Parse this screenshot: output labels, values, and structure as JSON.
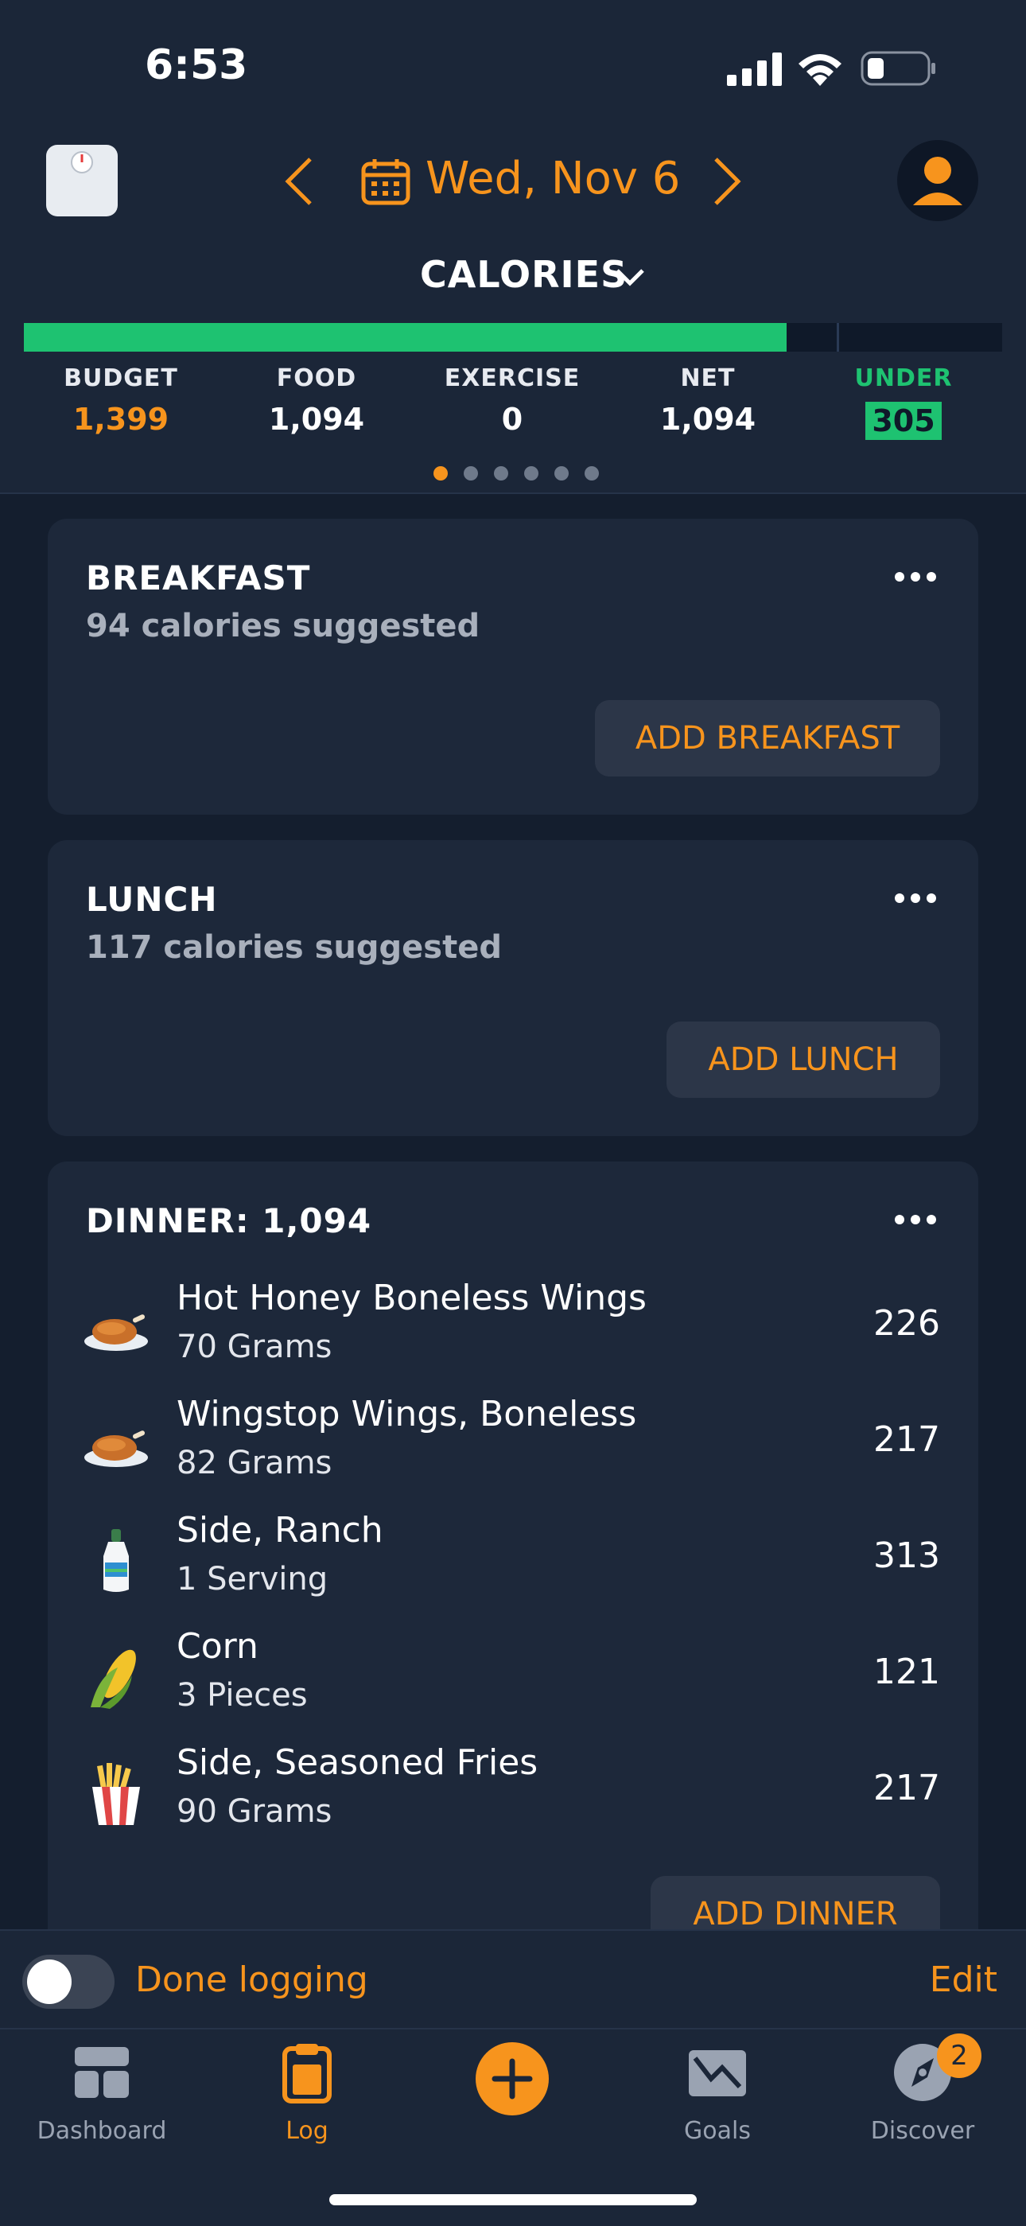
{
  "status_bar": {
    "time": "6:53"
  },
  "header": {
    "date": "Wed, Nov 6",
    "metric": "CALORIES"
  },
  "summary": {
    "progress_fraction": 0.78,
    "columns": [
      {
        "label": "BUDGET",
        "value": "1,399",
        "color": "#f7941d"
      },
      {
        "label": "FOOD",
        "value": "1,094",
        "color": "#ffffff"
      },
      {
        "label": "EXERCISE",
        "value": "0",
        "color": "#ffffff"
      },
      {
        "label": "NET",
        "value": "1,094",
        "color": "#ffffff"
      },
      {
        "label": "UNDER",
        "value": "305",
        "color": "#1ec271"
      }
    ],
    "page_count": 6,
    "active_page": 1
  },
  "meals": {
    "breakfast": {
      "title": "BREAKFAST",
      "suggested": "94 calories suggested",
      "add_label": "ADD BREAKFAST"
    },
    "lunch": {
      "title": "LUNCH",
      "suggested": "117 calories suggested",
      "add_label": "ADD LUNCH"
    },
    "dinner": {
      "title": "DINNER: 1,094",
      "add_label": "ADD DINNER",
      "items": [
        {
          "name": "Hot Honey Boneless Wings",
          "amount": "70 Grams",
          "calories": "226",
          "icon": "chicken-icon"
        },
        {
          "name": "Wingstop Wings, Boneless",
          "amount": "82 Grams",
          "calories": "217",
          "icon": "chicken-icon"
        },
        {
          "name": "Side, Ranch",
          "amount": "1 Serving",
          "calories": "313",
          "icon": "ranch-bottle-icon"
        },
        {
          "name": "Corn",
          "amount": "3 Pieces",
          "calories": "121",
          "icon": "corn-icon"
        },
        {
          "name": "Side, Seasoned Fries",
          "amount": "90 Grams",
          "calories": "217",
          "icon": "fries-icon"
        }
      ]
    }
  },
  "done_logging": {
    "label": "Done logging",
    "edit_label": "Edit",
    "enabled": false
  },
  "tabbar": {
    "tabs": [
      {
        "label": "Dashboard",
        "icon": "dashboard-icon"
      },
      {
        "label": "Log",
        "icon": "clipboard-icon"
      },
      {
        "label": "",
        "icon": "add-icon"
      },
      {
        "label": "Goals",
        "icon": "goals-icon"
      },
      {
        "label": "Discover",
        "icon": "compass-icon"
      }
    ],
    "discover_badge": "2"
  },
  "colors": {
    "accent": "#f7941d",
    "success": "#1ec271",
    "background": "#141e2e"
  }
}
